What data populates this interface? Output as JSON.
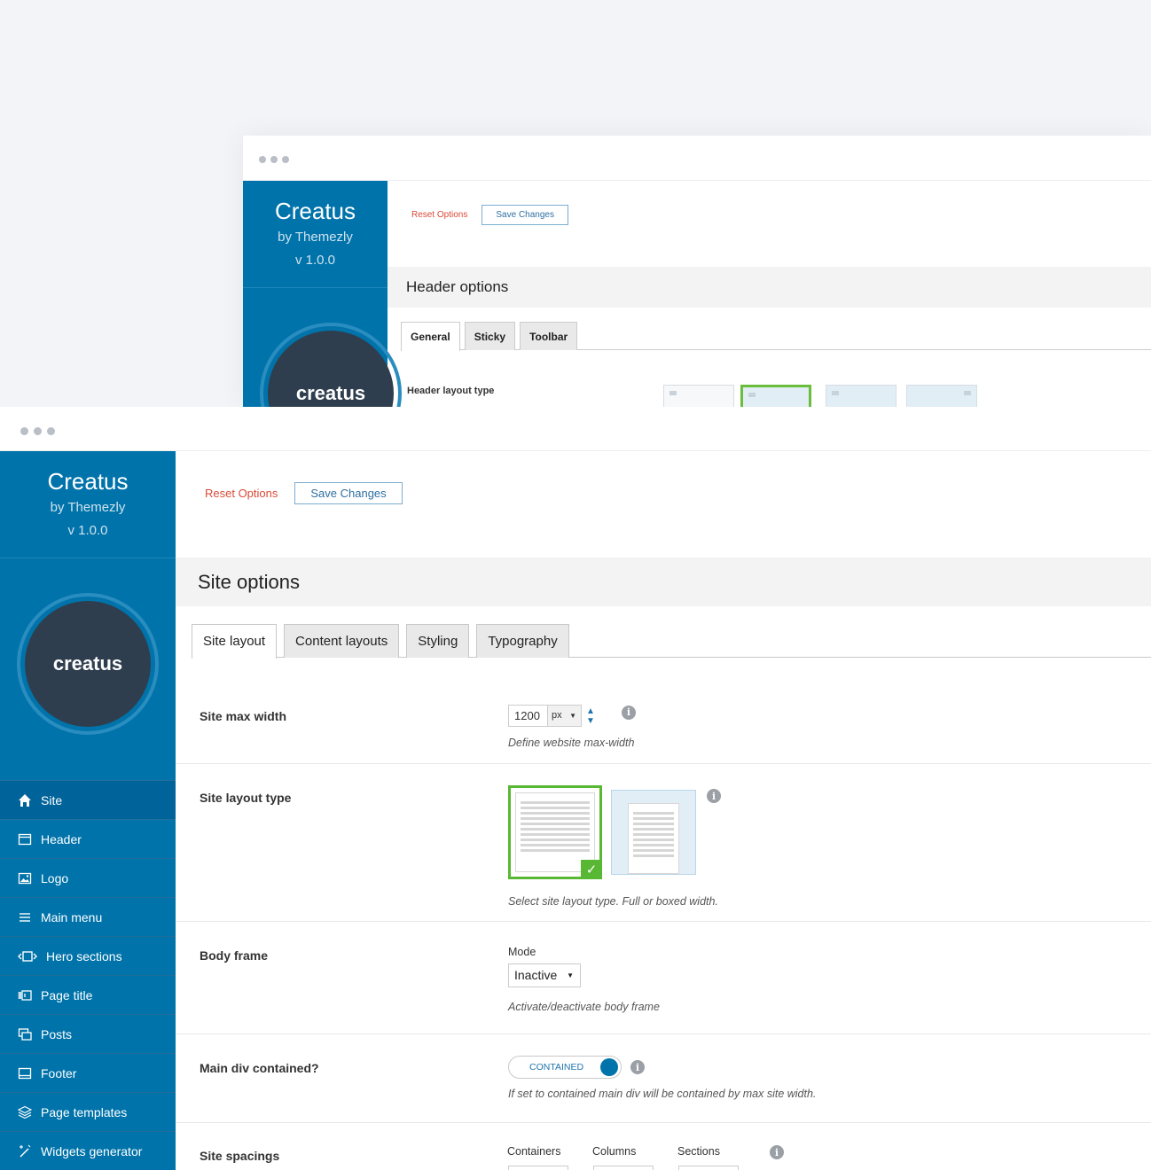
{
  "back": {
    "brand": {
      "name": "Creatus",
      "by": "by Themezly",
      "version": "v 1.0.0"
    },
    "logo_text": "creatus",
    "actions": {
      "reset": "Reset Options",
      "save": "Save Changes"
    },
    "section_title": "Header options",
    "tabs": [
      "General",
      "Sticky",
      "Toolbar"
    ],
    "row_label": "Header layout type"
  },
  "front": {
    "brand": {
      "name": "Creatus",
      "by": "by Themezly",
      "version": "v 1.0.0"
    },
    "logo_text": "creatus",
    "nav": [
      {
        "label": "Site",
        "icon": "home-icon"
      },
      {
        "label": "Header",
        "icon": "window-icon"
      },
      {
        "label": "Logo",
        "icon": "image-icon"
      },
      {
        "label": "Main menu",
        "icon": "menu-icon"
      },
      {
        "label": "Hero sections",
        "icon": "slides-icon"
      },
      {
        "label": "Page title",
        "icon": "title-icon"
      },
      {
        "label": "Posts",
        "icon": "posts-icon"
      },
      {
        "label": "Footer",
        "icon": "footer-icon"
      },
      {
        "label": "Page templates",
        "icon": "layers-icon"
      },
      {
        "label": "Widgets generator",
        "icon": "wand-icon"
      }
    ],
    "actions": {
      "reset": "Reset Options",
      "save": "Save Changes"
    },
    "section_title": "Site options",
    "tabs": [
      "Site layout",
      "Content layouts",
      "Styling",
      "Typography"
    ],
    "rows": {
      "max_width": {
        "label": "Site max width",
        "value": "1200",
        "unit": "px",
        "desc": "Define website max-width"
      },
      "layout_type": {
        "label": "Site layout type",
        "desc": "Select site layout type. Full or boxed width.",
        "selected": "full"
      },
      "body_frame": {
        "label": "Body frame",
        "mode_label": "Mode",
        "value": "Inactive",
        "desc": "Activate/deactivate body frame"
      },
      "main_div": {
        "label": "Main div contained?",
        "toggle": "CONTAINED",
        "desc": "If set to contained main div will be contained by max site width."
      },
      "spacings": {
        "label": "Site spacings",
        "cols": [
          "Containers",
          "Columns",
          "Sections"
        ]
      }
    }
  },
  "colors": {
    "accent": "#0073aa",
    "selected": "#59b833",
    "reset": "#d94a38"
  }
}
